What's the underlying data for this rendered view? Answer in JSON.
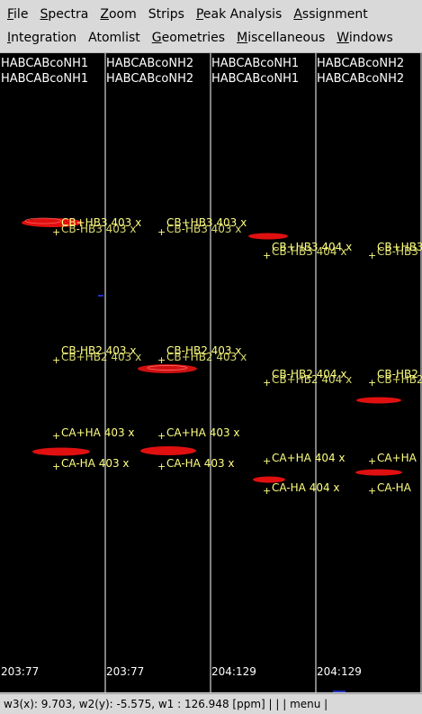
{
  "menubar": {
    "row1": [
      {
        "u": "F",
        "rest": "ile"
      },
      {
        "u": "S",
        "rest": "pectra"
      },
      {
        "u": "Z",
        "rest": "oom"
      },
      {
        "u": "",
        "rest": "Strips"
      },
      {
        "u": "P",
        "rest": "eak Analysis"
      },
      {
        "u": "A",
        "rest": "ssignment"
      }
    ],
    "row2": [
      {
        "u": "I",
        "rest": "ntegration"
      },
      {
        "u": "",
        "rest": "Atomlist"
      },
      {
        "u": "G",
        "rest": "eometries"
      },
      {
        "u": "M",
        "rest": "iscellaneous"
      },
      {
        "u": "W",
        "rest": "indows"
      }
    ]
  },
  "strips": [
    {
      "header1": "HABCABcoNH1",
      "header2": "HABCABcoNH1",
      "footer": "203:77"
    },
    {
      "header1": "HABCABcoNH2",
      "header2": "HABCABcoNH2",
      "footer": "203:77"
    },
    {
      "header1": "HABCABcoNH1",
      "header2": "HABCABcoNH1",
      "footer": "204:129"
    },
    {
      "header1": "HABCABcoNH2",
      "header2": "HABCABcoNH2",
      "footer": "204:129"
    }
  ],
  "peak_labels": [
    {
      "strip": 0,
      "text": "CB+HB3 403 x",
      "ghost": "CB-HB3 403 x",
      "pos": "a"
    },
    {
      "strip": 1,
      "text": "CB+HB3 403 x",
      "ghost": "CB-HB3 403 x",
      "pos": "a"
    },
    {
      "strip": 2,
      "text": "CB+HB3 404 x",
      "ghost": "CB-HB3 404 x",
      "pos": "b"
    },
    {
      "strip": 3,
      "text": "CB+HB3",
      "ghost": "CB-HB3",
      "pos": "b"
    },
    {
      "strip": 0,
      "text": "CB-HB2 403 x",
      "ghost": "CB+HB2 403 x",
      "pos": "c"
    },
    {
      "strip": 1,
      "text": "CB-HB2 403 x",
      "ghost": "CB+HB2 403 x",
      "pos": "c"
    },
    {
      "strip": 2,
      "text": "CB-HB2 404 x",
      "ghost": "CB+HB2 404 x",
      "pos": "d"
    },
    {
      "strip": 3,
      "text": "CB-HB2",
      "ghost": "CB+HB2",
      "pos": "d"
    },
    {
      "strip": 0,
      "text": "CA+HA 403 x",
      "pos": "e"
    },
    {
      "strip": 1,
      "text": "CA+HA 403 x",
      "pos": "e"
    },
    {
      "strip": 0,
      "text": "CA-HA 403 x",
      "pos": "f"
    },
    {
      "strip": 1,
      "text": "CA-HA 403 x",
      "pos": "f"
    },
    {
      "strip": 2,
      "text": "CA+HA 404 x",
      "pos": "g"
    },
    {
      "strip": 3,
      "text": "CA+HA",
      "pos": "g"
    },
    {
      "strip": 2,
      "text": "CA-HA 404 x",
      "pos": "h"
    },
    {
      "strip": 3,
      "text": "CA-HA",
      "pos": "h"
    }
  ],
  "status": {
    "text": "w3(x):   9.703, w2(y):  -5.575, w1   : 126.948 [ppm] |    |    | menu |"
  },
  "colors": {
    "background": "#000000",
    "peak_fill": "#e01010",
    "label": "#ffff80",
    "divider": "#ffffff"
  }
}
